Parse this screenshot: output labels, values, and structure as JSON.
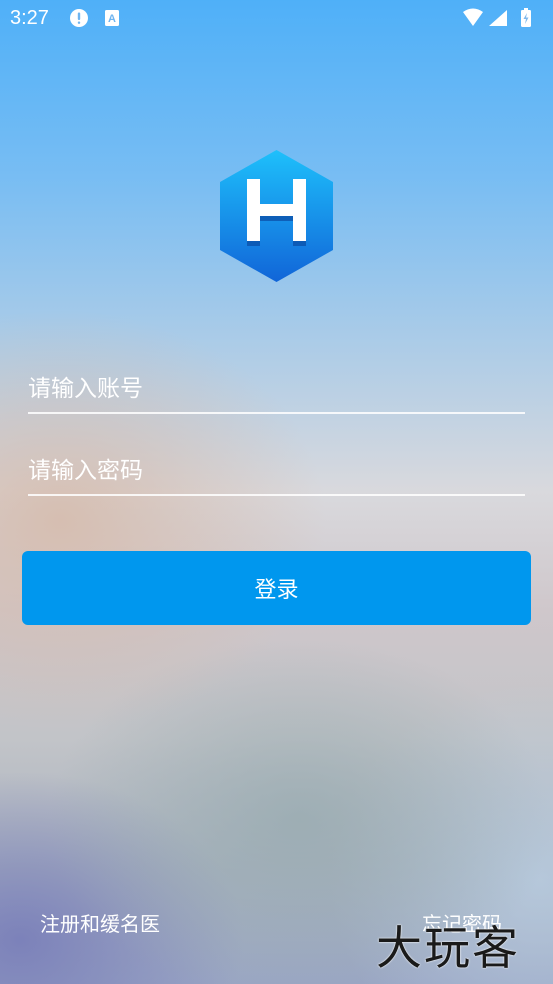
{
  "status_bar": {
    "time": "3:27",
    "icons": [
      "alert-icon",
      "a-notification-icon",
      "wifi-icon",
      "signal-icon",
      "battery-charging-icon"
    ]
  },
  "logo": {
    "letter": "H",
    "icon": "hexagon-logo-icon",
    "color": "#1a8ff0"
  },
  "form": {
    "account_placeholder": "请输入账号",
    "account_value": "",
    "password_placeholder": "请输入密码",
    "password_value": "",
    "login_label": "登录",
    "login_color": "#0097ee"
  },
  "footer": {
    "register_label": "注册和缓名医",
    "forgot_label": "忘记密码"
  },
  "watermark": {
    "text": "大玩客"
  }
}
